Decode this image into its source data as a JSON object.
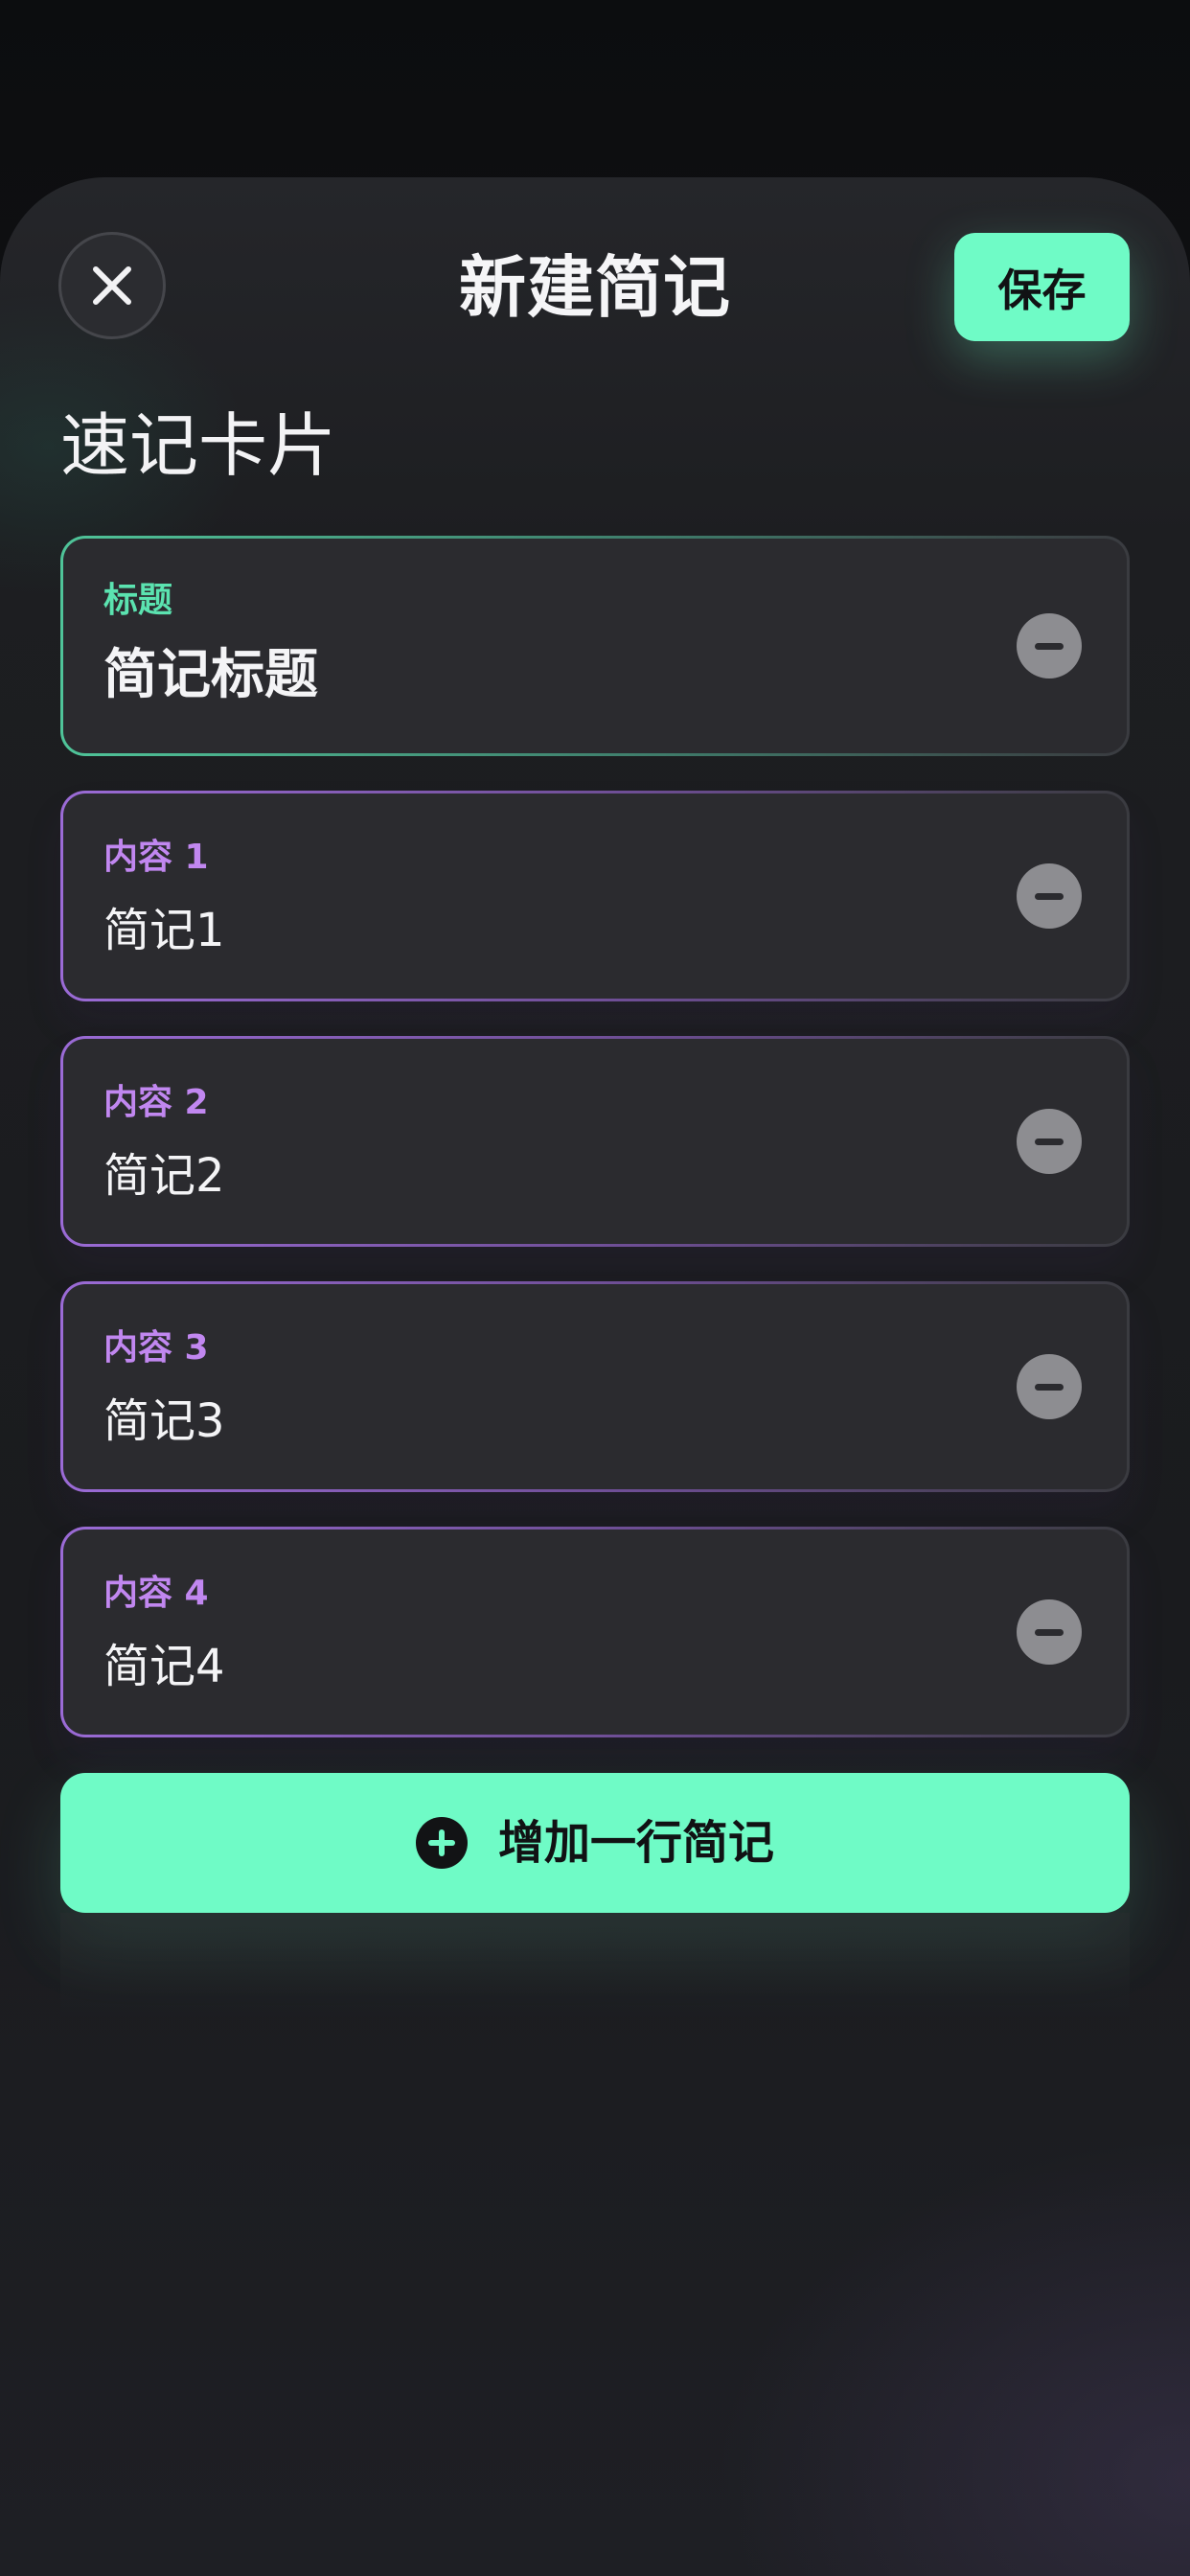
{
  "header": {
    "title": "新建简记",
    "save_label": "保存",
    "close_icon": "close-icon"
  },
  "section": {
    "title": "速记卡片"
  },
  "title_card": {
    "label": "标题",
    "value": "简记标题"
  },
  "content_cards": [
    {
      "label": "内容 1",
      "value": "简记1"
    },
    {
      "label": "内容 2",
      "value": "简记2"
    },
    {
      "label": "内容 3",
      "value": "简记3"
    },
    {
      "label": "内容 4",
      "value": "简记4"
    }
  ],
  "add_button": {
    "label": "增加一行简记",
    "icon": "plus-circle-icon"
  },
  "colors": {
    "accent_green": "#6ffbc6",
    "label_green": "#5be3b0",
    "label_purple": "#c187f0",
    "card_bg": "#2b2b2f"
  }
}
